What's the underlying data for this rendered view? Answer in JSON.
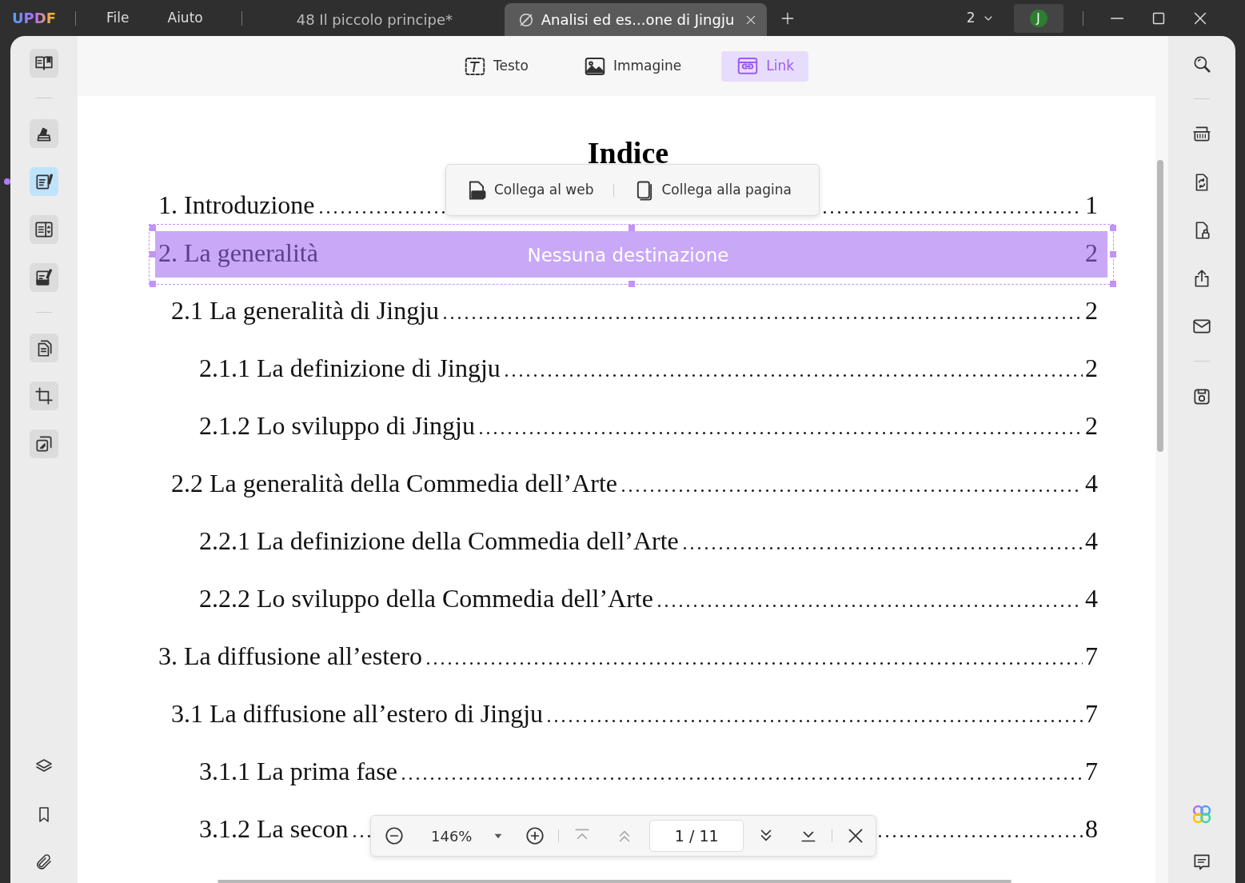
{
  "app": {
    "logo": "UPDF",
    "menu": [
      "File",
      "Aiuto"
    ]
  },
  "tabs": [
    {
      "label": "48 Il piccolo principe*",
      "selected": false
    },
    {
      "label": "Analisi ed es...one di Jingju",
      "selected": true
    }
  ],
  "window_count": "2",
  "avatar": "J",
  "left_tools": [
    {
      "selected": false
    },
    {
      "selected": false
    },
    {
      "selected": true
    },
    {
      "selected": false
    },
    {
      "selected": false
    },
    {
      "selected": false
    },
    {
      "selected": false
    },
    {
      "selected": false
    }
  ],
  "edit_modes": [
    {
      "label": "Testo",
      "selected": false
    },
    {
      "label": "Immagine",
      "selected": false
    },
    {
      "label": "Link",
      "selected": true
    }
  ],
  "document": {
    "title": "Indice",
    "toc": [
      {
        "text": "1. Introduzione",
        "page": "1",
        "selected": false
      },
      {
        "text": "2. La generalità",
        "page": "2",
        "selected": true,
        "link_hint": "Nessuna destinazione",
        "children": [
          {
            "text": "2.1 La generalità di Jingju",
            "page": "2",
            "selected": false,
            "children": [
              {
                "text": "2.1.1 La definizione di Jingju",
                "page": "2",
                "selected": false
              },
              {
                "text": "2.1.2 Lo sviluppo di Jingju",
                "page": "2",
                "selected": false
              }
            ]
          },
          {
            "text": "2.2 La generalità della Commedia dell’Arte",
            "page": "4",
            "selected": false,
            "children": [
              {
                "text": "2.2.1 La definizione della Commedia dell’Arte",
                "page": "4",
                "selected": false
              },
              {
                "text": "2.2.2 Lo sviluppo della Commedia dell’Arte",
                "page": "4",
                "selected": false
              }
            ]
          }
        ]
      },
      {
        "text": "3. La diffusione all’estero",
        "page": "7",
        "selected": false,
        "children": [
          {
            "text": "3.1 La diffusione all’estero di Jingju",
            "page": "7",
            "selected": false,
            "children": [
              {
                "text": "3.1.1 La prima fase",
                "page": "7",
                "selected": false
              },
              {
                "text": "3.1.2 La secon",
                "page": "8",
                "selected": false
              }
            ]
          }
        ]
      }
    ]
  },
  "link_popup": {
    "options": [
      "Collega al web",
      "Collega alla pagina"
    ]
  },
  "page_toolbar": {
    "zoom": "146%",
    "page_indicator": "1 / 11"
  }
}
